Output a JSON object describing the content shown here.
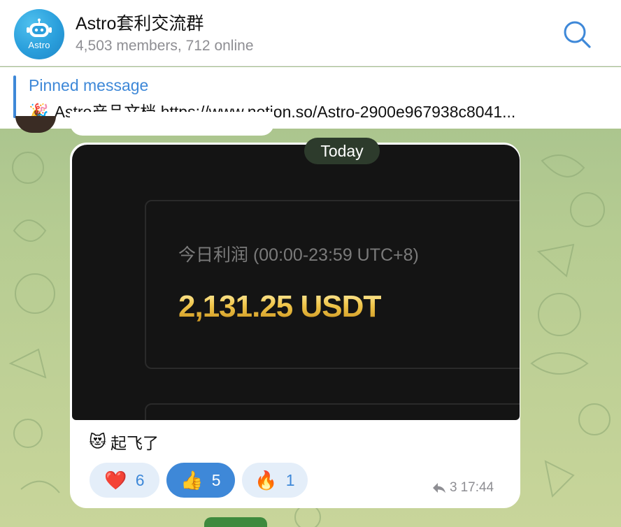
{
  "header": {
    "avatar_text": "Astro",
    "title": "Astro套利交流群",
    "subtitle": "4,503 members, 712 online",
    "search_icon": "search-icon",
    "accent_color": "#3e88d8"
  },
  "pinned": {
    "title": "Pinned message",
    "emoji": "🎉",
    "text": "Astro产品文档 https://www.notion.so/Astro-2900e967938c8041..."
  },
  "message": {
    "date_label": "Today",
    "image": {
      "label": "今日利润 (00:00-23:59 UTC+8)",
      "value": "2,131.25 USDT"
    },
    "caption_emoji": "😻",
    "caption": "起飞了",
    "reactions": [
      {
        "emoji": "❤️",
        "count": "6",
        "active": false
      },
      {
        "emoji": "👍",
        "count": "5",
        "active": true
      },
      {
        "emoji": "🔥",
        "count": "1",
        "active": false
      }
    ],
    "forward_count": "3",
    "time": "17:44"
  }
}
